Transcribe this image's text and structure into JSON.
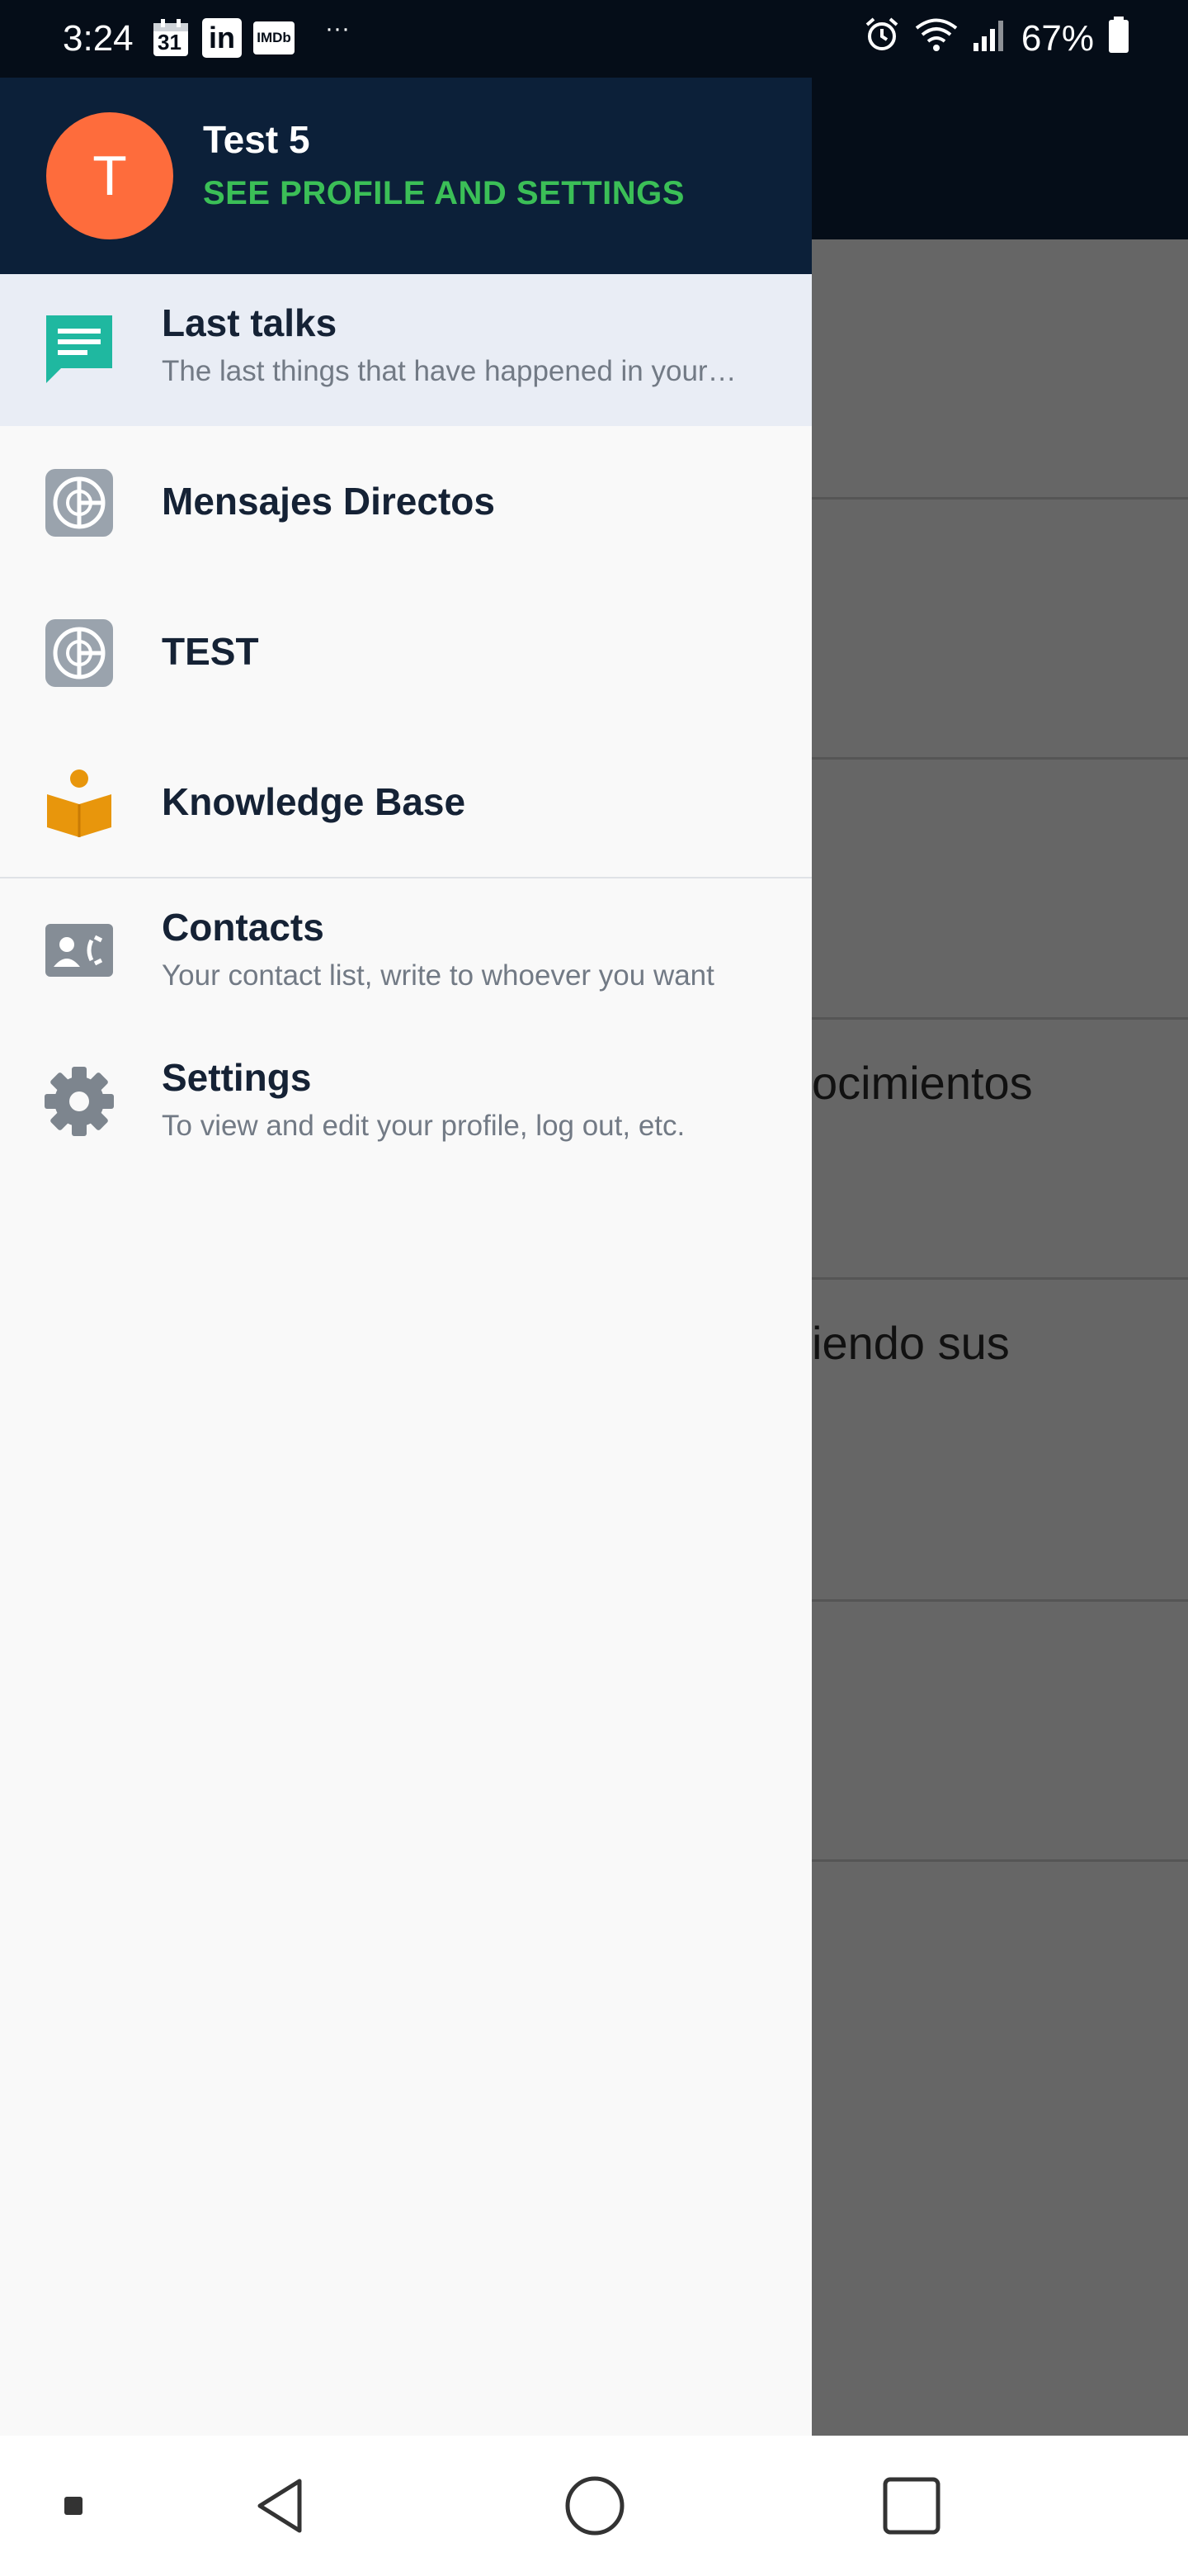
{
  "status_bar": {
    "time": "3:24",
    "calendar_badge": "31",
    "linkedin_label": "in",
    "imdb_label": "IMDb",
    "more": "···",
    "battery": "67%"
  },
  "background": {
    "visible_fragments": [
      "ocimientos",
      "iendo sus"
    ]
  },
  "drawer": {
    "header": {
      "avatar_letter": "T",
      "username": "Test 5",
      "profile_link": "SEE PROFILE AND SETTINGS"
    },
    "items": [
      {
        "title": "Last talks",
        "subtitle": "The last things that have happened in your …",
        "icon": "chat-icon",
        "color": "#1fb8a0",
        "active": true
      },
      {
        "title": "Mensajes Directos",
        "icon": "space-icon",
        "color": "#9aa3ad"
      },
      {
        "title": "TEST",
        "icon": "space-icon",
        "color": "#9aa3ad"
      },
      {
        "title": "Knowledge Base",
        "icon": "book-reader-icon",
        "color": "#e8960c"
      },
      {
        "title": "Contacts",
        "subtitle": "Your contact list, write to whoever you want",
        "icon": "contact-card-icon",
        "color": "#858d96"
      },
      {
        "title": "Settings",
        "subtitle": "To view and edit your profile, log out, etc.",
        "icon": "gear-icon",
        "color": "#7d858e"
      }
    ]
  },
  "nav_bar": {
    "buttons": [
      "menu-dot",
      "back",
      "home",
      "recents"
    ]
  }
}
